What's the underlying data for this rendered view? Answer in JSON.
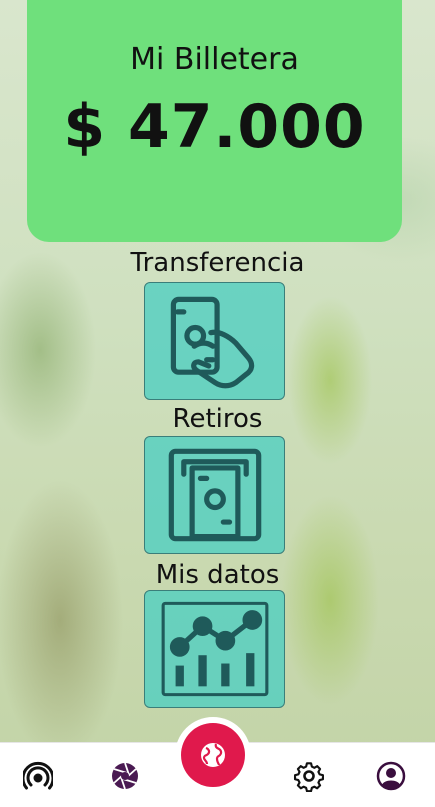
{
  "wallet": {
    "title": "Mi Billetera",
    "amount": "$ 47.000",
    "color": "#6fe07c"
  },
  "actions": [
    {
      "label": "Transferencia",
      "icon": "hand-cash-icon"
    },
    {
      "label": "Retiros",
      "icon": "atm-withdraw-icon"
    },
    {
      "label": "Mis datos",
      "icon": "line-chart-icon"
    }
  ],
  "nav": {
    "items": [
      {
        "icon": "broadcast-icon"
      },
      {
        "icon": "aperture-icon"
      },
      {
        "icon": "globe-icon",
        "active": true,
        "color": "#e0194c"
      },
      {
        "icon": "gear-icon"
      },
      {
        "icon": "user-icon"
      }
    ]
  },
  "colors": {
    "tile": "#4dcec2",
    "icon_stroke": "#1f5a5a",
    "accent": "#e0194c"
  }
}
